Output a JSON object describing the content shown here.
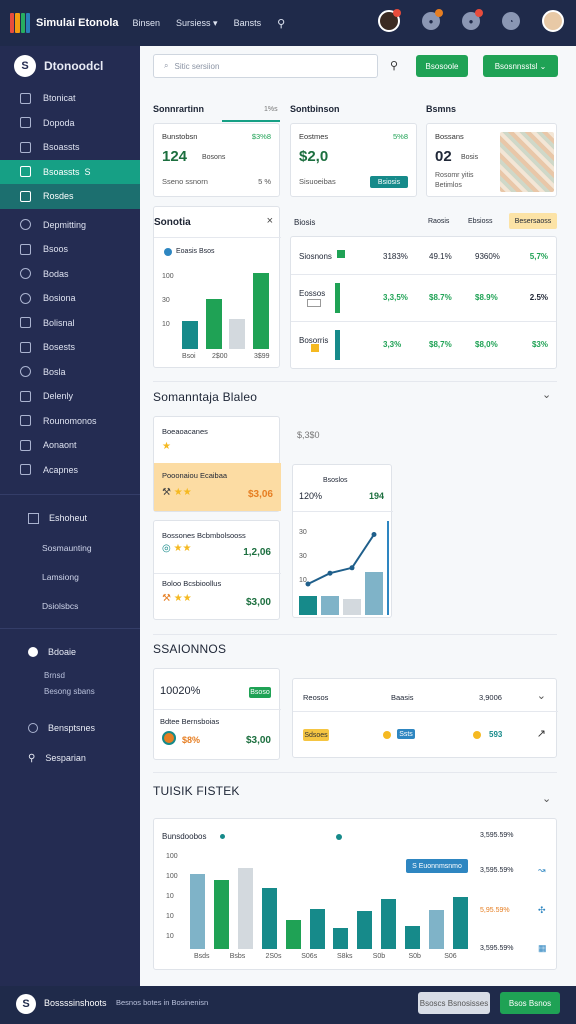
{
  "topbar": {
    "title": "Simulai Etonola",
    "nav": [
      "Binsen",
      "Sursiess ▾",
      "Bansts"
    ],
    "brand_colors": [
      "#e74c3c",
      "#f39c12",
      "#27ae60",
      "#2980b9"
    ]
  },
  "sidebar": {
    "title": "Dtonoodcl",
    "logo_glyph": "S",
    "items": [
      "Btonicat",
      "Dopoda",
      "Bsoassts",
      "Rosdes",
      "Depmitting",
      "Bsoos",
      "Bodas",
      "Bosiona",
      "Bolisnal",
      "Bosests",
      "Bosla",
      "Delenly",
      "Rounomonos",
      "Aonaont",
      "Acapnes"
    ],
    "active_badge": "S",
    "section": "Eshoheut",
    "subs": [
      "Sosmaunting",
      "Lamsiong",
      "Dsiolsbcs"
    ],
    "section2": "Bdoaie",
    "small": [
      "Brnsd",
      "Besong sbans"
    ],
    "bottom": [
      "Bensptsnes",
      "Sesparian"
    ]
  },
  "toolbar": {
    "search_placeholder": "Sitic sersiion",
    "btn1": "Bsosoole",
    "btn2": "Bsosnnsstsl ⌄"
  },
  "kpis": [
    {
      "section": "Sonnrartinn",
      "section_right": "1%s",
      "label": "Bunstobsn",
      "pct": "$3%8",
      "value": "124",
      "value_note": "Bosons",
      "sub": "Sseno ssnorn",
      "sub2": "5 %"
    },
    {
      "section": "Sontbinson",
      "label": "Eostmes",
      "pct": "5%8",
      "value": "$2,0",
      "sub": "Sisuoeibas",
      "badge": "Bsiosis"
    },
    {
      "section": "Bsmns",
      "label": "Bossans",
      "value": "02",
      "value_note": "Bosis",
      "sub1": "Rosomr yitis",
      "sub2": "Betimlos"
    }
  ],
  "overview": {
    "title": "Sonotia",
    "close": "×",
    "legend": "Eoasis Bsos",
    "y_ticks": [
      "100",
      "30",
      "10"
    ],
    "x_ticks": [
      "Bsoi",
      "2$00",
      "3$99"
    ]
  },
  "table": {
    "title": "Biosis",
    "tabs": [
      "Raosis",
      "Ebsioss",
      "Besersaoss"
    ],
    "rows": [
      {
        "name": "Siosnons",
        "cols": [
          "3183%",
          "49.1%",
          "9360%",
          "5,7%"
        ]
      },
      {
        "name": "Eossos",
        "cols": [
          "3,3,5%",
          "$8.7%",
          "$8.9%",
          "2.5%"
        ]
      },
      {
        "name": "Bosorris",
        "cols": [
          "3,3%",
          "$8,7%",
          "$8,0%",
          "$3%"
        ]
      }
    ]
  },
  "section2": {
    "title": "Somanntaja Blaleo",
    "chevron": "⌄",
    "list": [
      {
        "title": "Boeaoacanes",
        "value": ""
      },
      {
        "title": "Pooonaiou Ecaibaa",
        "value": "$3,06",
        "highlight": true
      },
      {
        "title": "Bossones Bcbmbolsooss",
        "value": "1,2,06"
      },
      {
        "title": "Boloo Bcsbioollus",
        "value": "$3,00"
      }
    ],
    "price": "$,3$0",
    "mini": {
      "label": "Bsoslos",
      "a": "120%",
      "b": "194",
      "y_ticks": [
        "30",
        "30",
        "10"
      ]
    }
  },
  "section3": {
    "title": "SSAIONNOS",
    "card": {
      "value": "10020%",
      "badge": "Bsoso",
      "label": "Bdtee Bernsboias",
      "pct": "$8%",
      "amount": "$3,00"
    },
    "row": {
      "h1": "Reosos",
      "h2": "Baasis",
      "h3": "3,9006",
      "badge": "Sdsoes",
      "chip": "Ssts",
      "val": "593"
    }
  },
  "section4": {
    "title": "TUISIK FISTEK",
    "chevron": "⌄",
    "card_title": "Bunsdoobos",
    "tooltip": "S Euonnmsnmo",
    "y_ticks": [
      "100",
      "100",
      "10",
      "10",
      "10"
    ],
    "x_ticks": [
      "Bsds",
      "Bsbs",
      "2S0s",
      "S06s",
      "S8ks",
      "S0b",
      "S0b",
      "S06"
    ],
    "side": [
      {
        "label": "3,595.59%",
        "color": "#333"
      },
      {
        "label": "5,95.59%",
        "color": "#e67e22"
      },
      {
        "label": "3,595.59%",
        "color": "#333"
      }
    ],
    "bars": [
      {
        "v": 78,
        "c": "#7fb3c8"
      },
      {
        "v": 72,
        "c": "#1fa255"
      },
      {
        "v": 84,
        "c": "#d3d9de"
      },
      {
        "v": 64,
        "c": "#168a8a"
      },
      {
        "v": 30,
        "c": "#1fa255"
      },
      {
        "v": 42,
        "c": "#168a8a"
      },
      {
        "v": 22,
        "c": "#168a8a"
      },
      {
        "v": 40,
        "c": "#168a8a"
      },
      {
        "v": 52,
        "c": "#168a8a"
      },
      {
        "v": 24,
        "c": "#168a8a"
      },
      {
        "v": 41,
        "c": "#7fb3c8"
      },
      {
        "v": 54,
        "c": "#168a8a"
      }
    ]
  },
  "chart_small": {
    "bars": [
      {
        "v": 0.35,
        "c": "#168a8a"
      },
      {
        "v": 0.62,
        "c": "#1fa255"
      },
      {
        "v": 0.38,
        "c": "#d3d9de"
      },
      {
        "v": 0.95,
        "c": "#1fa255"
      }
    ]
  },
  "mini_chart": {
    "bars": [
      {
        "v": 0.35,
        "c": "#168a8a"
      },
      {
        "v": 0.35,
        "c": "#7fb3c8"
      },
      {
        "v": 0.3,
        "c": "#d3d9de"
      },
      {
        "v": 0.8,
        "c": "#7fb3c8"
      }
    ],
    "line": [
      0.3,
      0.42,
      0.48,
      0.85
    ]
  },
  "footer": {
    "title": "Bossssinshoots",
    "sub": "Besnos botes in Bosinenisn",
    "btn1": "Bsoscs Bsnosisses",
    "btn2": "Bsos Bsnos"
  }
}
